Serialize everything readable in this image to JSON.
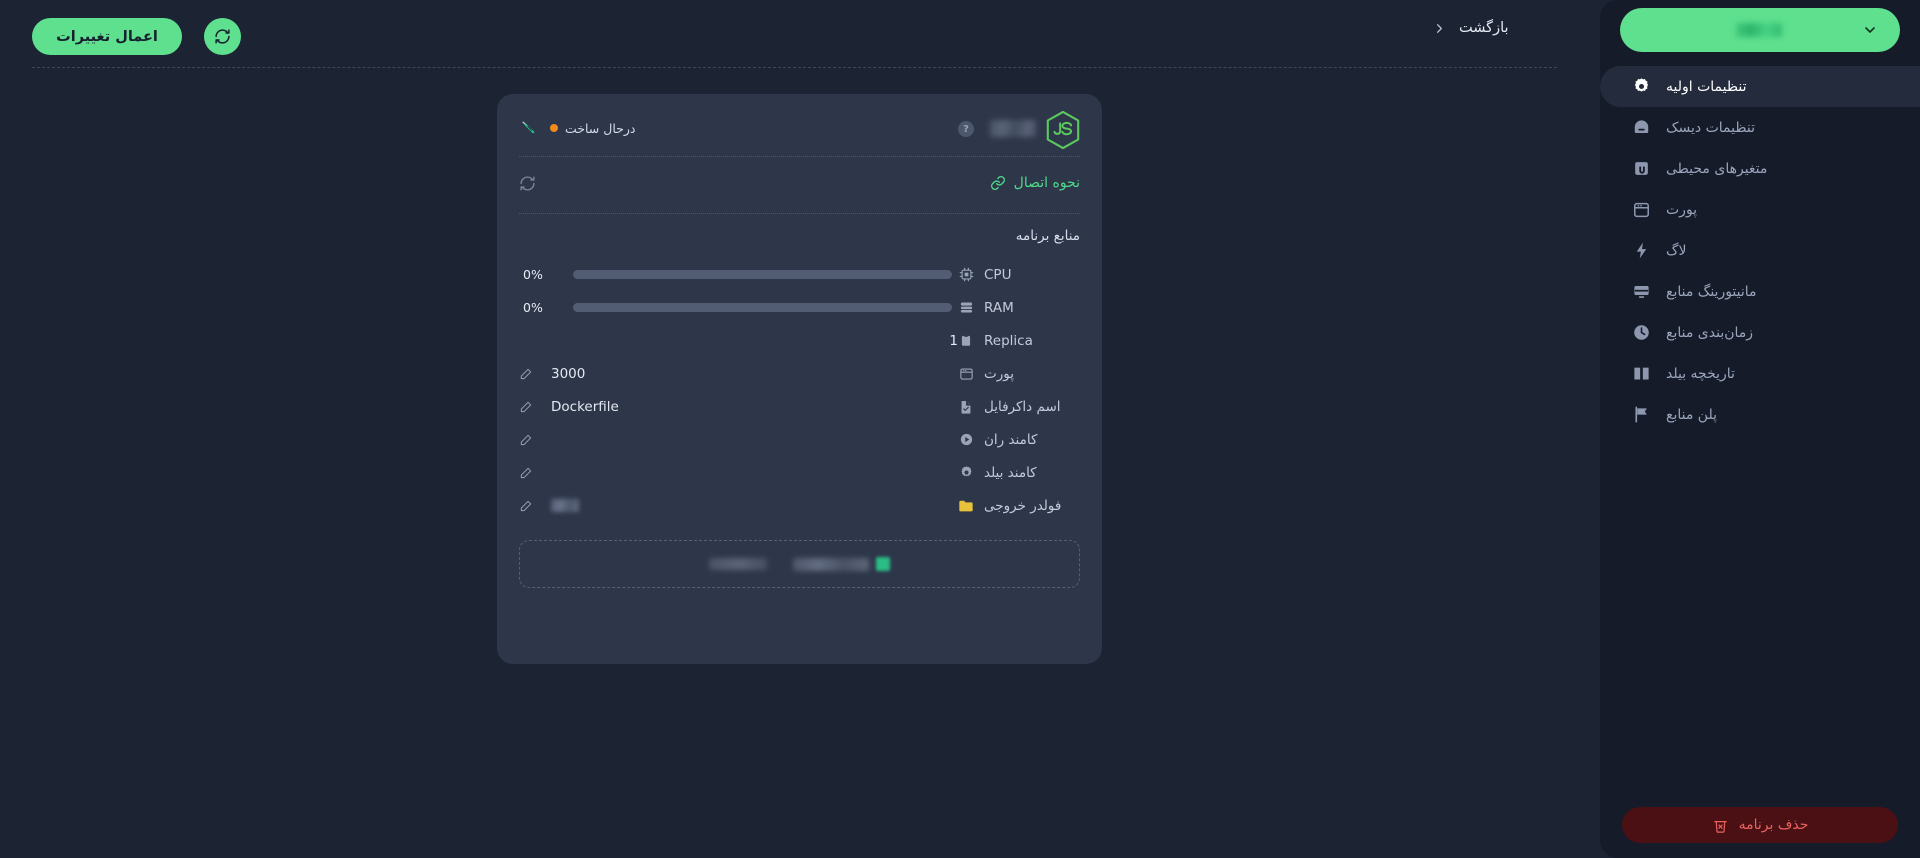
{
  "toolbar": {
    "apply_label": "اعمال تغییرات",
    "refresh_icon": "refresh-icon",
    "back_label": "بازگشت",
    "back_chevron_icon": "chevron-left-icon"
  },
  "sidebar": {
    "project_selector": {
      "name_masked": "",
      "chevron_icon": "chevron-down-icon"
    },
    "items": [
      {
        "label": "تنظیمات اولیه",
        "icon": "gear-icon",
        "active": true
      },
      {
        "label": "تنظیمات دیسک",
        "icon": "disk-icon",
        "active": false
      },
      {
        "label": "متغیرهای محیطی",
        "icon": "env-variables-icon",
        "active": false
      },
      {
        "label": "پورت",
        "icon": "port-window-icon",
        "active": false
      },
      {
        "label": "لاگ",
        "icon": "lightning-icon",
        "active": false
      },
      {
        "label": "مانیتورینگ منابع",
        "icon": "monitor-icon",
        "active": false
      },
      {
        "label": "زمان‌بندی منابع",
        "icon": "clock-icon",
        "active": false
      },
      {
        "label": "تاریخچه بیلد",
        "icon": "book-icon",
        "active": false
      },
      {
        "label": "پلن منابع",
        "icon": "flag-icon",
        "active": false
      }
    ],
    "delete_button": {
      "label": "حذف برنامه",
      "icon": "trash-x-icon"
    }
  },
  "card": {
    "header": {
      "runtime_logo": "nodejs-js-icon",
      "app_name_masked": "",
      "help_icon": "question-mark-icon",
      "needle_icon": "needle-icon",
      "status_label": "درحال ساخت",
      "status_color": "#ef8a1b"
    },
    "connection": {
      "label": "نحوه اتصال",
      "link_icon": "link-icon",
      "refresh_icon": "refresh-icon",
      "accent_color": "#4fd98a"
    },
    "resources_title": "منابع برنامه",
    "rows": [
      {
        "label": "CPU",
        "icon": "cpu-chip-icon",
        "type": "bar",
        "value": "0%",
        "percent": 0
      },
      {
        "label": "RAM",
        "icon": "ram-server-icon",
        "type": "bar",
        "value": "0%",
        "percent": 0
      },
      {
        "label": "Replica",
        "icon": "clipboard-icon",
        "type": "plain",
        "value": "1",
        "editable": false
      },
      {
        "label": "پورت",
        "icon": "port-window-icon",
        "type": "edit",
        "value": "3000",
        "editable": true
      },
      {
        "label": "اسم داکرفایل",
        "icon": "file-check-icon",
        "type": "edit",
        "value": "Dockerfile",
        "editable": true
      },
      {
        "label": "کامند ران",
        "icon": "play-circle-icon",
        "type": "edit",
        "value": "",
        "editable": true
      },
      {
        "label": "کامند بیلد",
        "icon": "gear-icon",
        "type": "edit",
        "value": "",
        "editable": true
      },
      {
        "label": "فولدر خروجی",
        "icon": "folder-icon",
        "type": "edit",
        "value": "",
        "editable": true,
        "masked": true
      }
    ],
    "bottom_box": {
      "chip_a_masked": "",
      "chip_b_masked": "",
      "dashed": true
    }
  },
  "colors": {
    "page_bg": "#1c2333",
    "sidebar_bg": "#151b29",
    "card_bg": "#2e374a",
    "accent_green": "#5ee08f",
    "danger_red": "#e8625f",
    "status_orange": "#ef8a1b",
    "folder_yellow": "#e8c23a"
  }
}
